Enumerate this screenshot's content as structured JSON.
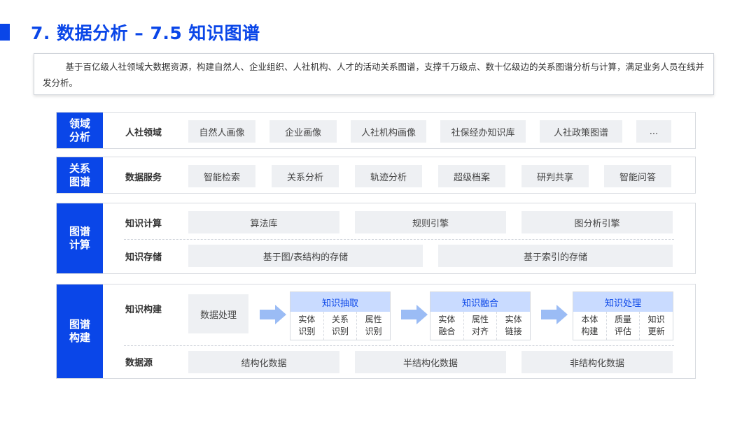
{
  "header": {
    "title": "7. 数据分析 – 7.5 知识图谱",
    "accent_color": "#0a46e8"
  },
  "intro": {
    "text": "基于百亿级人社领域大数据资源，构建自然人、企业组织、人社机构、人才的活动关系图谱，支撑千万级点、数十亿级边的关系图谱分析与计算，满足业务人员在线并发分析。"
  },
  "domain_section": {
    "label_line1": "领域",
    "label_line2": "分析",
    "row_label": "人社领域",
    "items": [
      "自然人画像",
      "企业画像",
      "人社机构画像",
      "社保经办知识库",
      "人社政策图谱",
      "..."
    ]
  },
  "relation_section": {
    "label_line1": "关系",
    "label_line2": "图谱",
    "row_label": "数据服务",
    "items": [
      "智能检索",
      "关系分析",
      "轨迹分析",
      "超级档案",
      "研判共享",
      "智能问答"
    ]
  },
  "compute_section": {
    "label_line1": "图谱",
    "label_line2": "计算",
    "compute_row": {
      "label": "知识计算",
      "items": [
        "算法库",
        "规则引擎",
        "图分析引擎"
      ]
    },
    "storage_row": {
      "label": "知识存储",
      "items": [
        "基于图/表结构的存储",
        "基于索引的存储"
      ]
    }
  },
  "build_section": {
    "label_line1": "图谱",
    "label_line2": "构建",
    "build_row": {
      "label": "知识构建",
      "start": "数据处理",
      "stages": [
        {
          "title": "知识抽取",
          "items": [
            [
              "实体",
              "识别"
            ],
            [
              "关系",
              "识别"
            ],
            [
              "属性",
              "识别"
            ]
          ]
        },
        {
          "title": "知识融合",
          "items": [
            [
              "实体",
              "融合"
            ],
            [
              "属性",
              "对齐"
            ],
            [
              "实体",
              "链接"
            ]
          ]
        },
        {
          "title": "知识处理",
          "items": [
            [
              "本体",
              "构建"
            ],
            [
              "质量",
              "评估"
            ],
            [
              "知识",
              "更新"
            ]
          ]
        }
      ]
    },
    "source_row": {
      "label": "数据源",
      "items": [
        "结构化数据",
        "半结构化数据",
        "非结构化数据"
      ]
    }
  }
}
